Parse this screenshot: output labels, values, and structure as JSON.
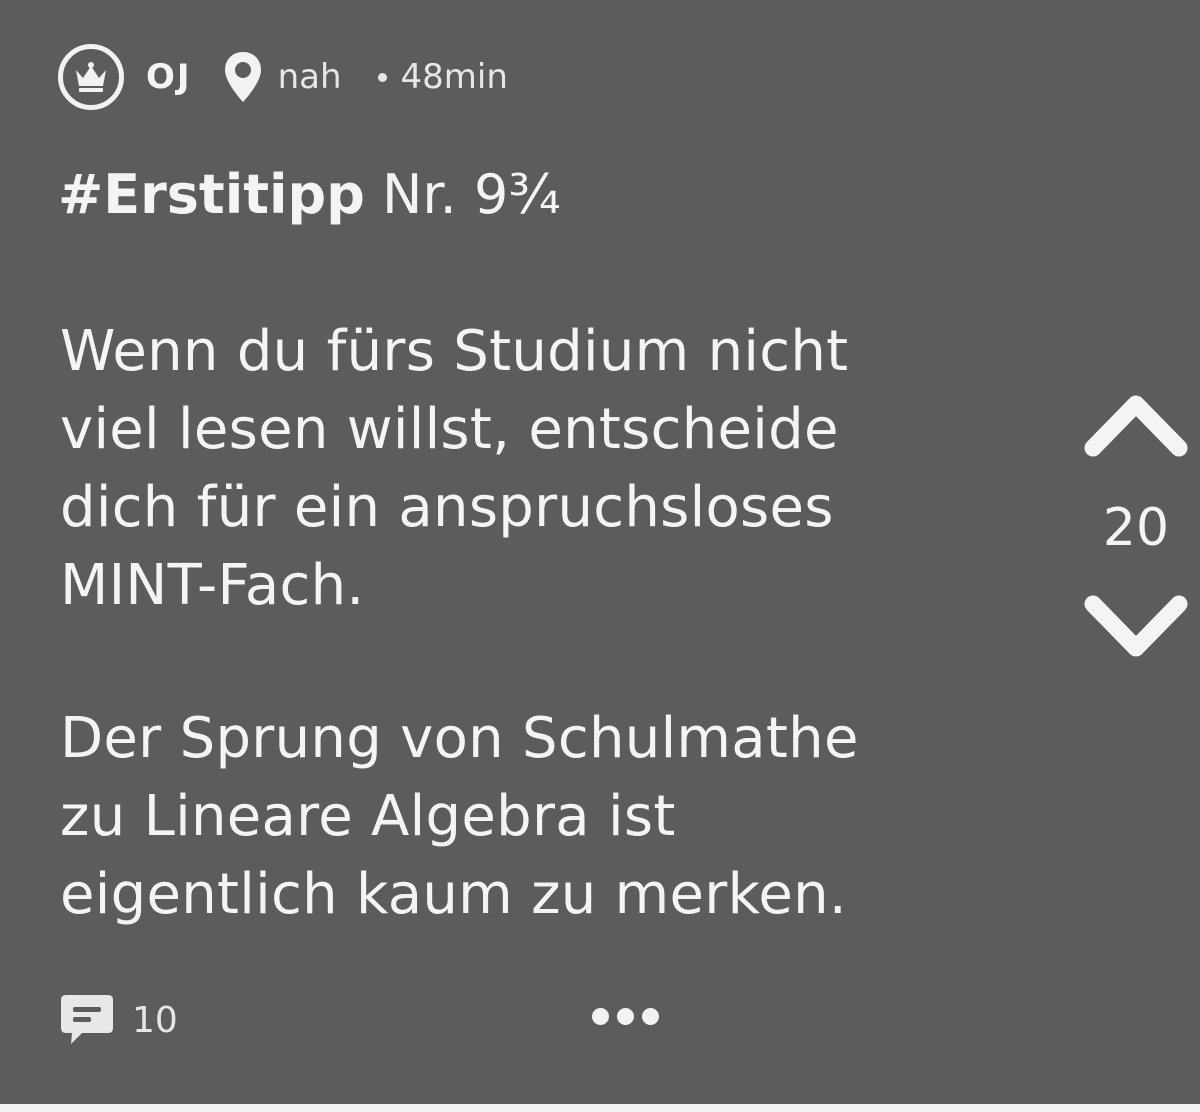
{
  "post": {
    "author": "OJ",
    "location": "nah",
    "time_ago": "48min",
    "hashtag": "#Erstitipp",
    "title_rest": " Nr. 9¾",
    "paragraph1": [
      "Wenn du fürs Studium nicht",
      "viel lesen willst, entscheide",
      "dich für ein anspruchsloses",
      "MINT-Fach."
    ],
    "paragraph2": [
      "Der Sprung von Schulmathe",
      "zu Lineare Algebra ist",
      "eigentlich kaum zu merken."
    ],
    "vote_count": "20",
    "comment_count": "10"
  },
  "icons": {
    "badge": "crown-icon",
    "location": "location-pin-icon",
    "upvote": "chevron-up-icon",
    "downvote": "chevron-down-icon",
    "comments": "comment-bubble-icon",
    "more": "more-dots-icon"
  },
  "colors": {
    "card_background": "#5c5c5c",
    "text": "#f4f4f4",
    "page_background": "#f2f2f2"
  }
}
